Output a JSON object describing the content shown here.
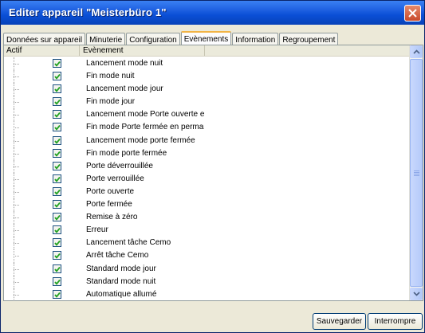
{
  "window": {
    "title": "Editer appareil \"Meisterbüro 1\""
  },
  "tabs": [
    {
      "label": "Données sur appareil",
      "active": false
    },
    {
      "label": "Minuterie",
      "active": false
    },
    {
      "label": "Configuration",
      "active": false
    },
    {
      "label": "Evènements",
      "active": true
    },
    {
      "label": "Information",
      "active": false
    },
    {
      "label": "Regroupement",
      "active": false
    }
  ],
  "table": {
    "columns": {
      "actif": "Actif",
      "event": "Evènement"
    },
    "rows": [
      {
        "checked": true,
        "event": "Lancement mode nuit"
      },
      {
        "checked": true,
        "event": "Fin mode nuit"
      },
      {
        "checked": true,
        "event": "Lancement mode jour"
      },
      {
        "checked": true,
        "event": "Fin mode jour"
      },
      {
        "checked": true,
        "event": "Lancement mode Porte ouverte en permanence"
      },
      {
        "checked": true,
        "event": "Fin mode Porte fermée en permanence"
      },
      {
        "checked": true,
        "event": "Lancement mode porte fermée"
      },
      {
        "checked": true,
        "event": "Fin mode porte fermée"
      },
      {
        "checked": true,
        "event": "Porte déverrouillée"
      },
      {
        "checked": true,
        "event": "Porte verrouillée"
      },
      {
        "checked": true,
        "event": "Porte ouverte"
      },
      {
        "checked": true,
        "event": "Porte fermée"
      },
      {
        "checked": true,
        "event": "Remise à zéro"
      },
      {
        "checked": true,
        "event": "Erreur"
      },
      {
        "checked": true,
        "event": "Lancement tâche Cemo"
      },
      {
        "checked": true,
        "event": "Arrêt tâche Cemo"
      },
      {
        "checked": true,
        "event": "Standard mode jour"
      },
      {
        "checked": true,
        "event": "Standard mode nuit"
      },
      {
        "checked": true,
        "event": "Automatique allumé"
      }
    ]
  },
  "buttons": {
    "save": "Sauvegarder",
    "stop": "Interrompre"
  }
}
